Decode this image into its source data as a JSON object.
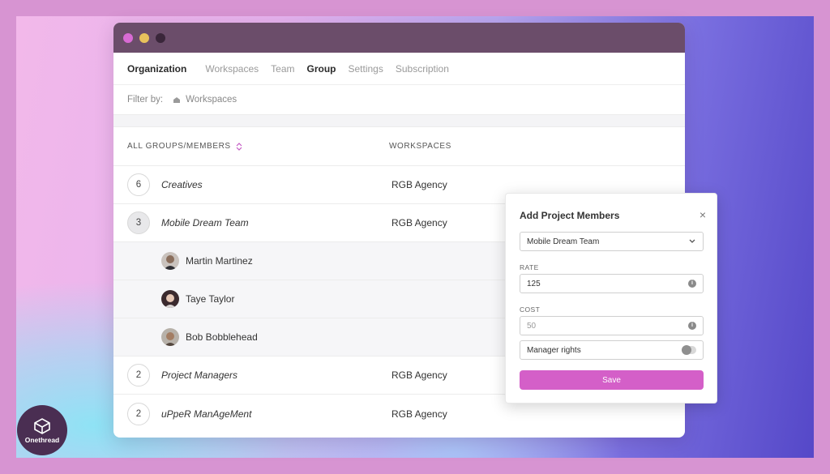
{
  "colors": {
    "dot_pink": "#d86bd4",
    "dot_yellow": "#e8c25c",
    "dot_dark": "#3a263a",
    "accent": "#d45fc8"
  },
  "nav": {
    "items": [
      {
        "label": "Organization",
        "bold": true
      },
      {
        "label": "Workspaces",
        "bold": false
      },
      {
        "label": "Team",
        "bold": false
      },
      {
        "label": "Group",
        "bold": true
      },
      {
        "label": "Settings",
        "bold": false
      },
      {
        "label": "Subscription",
        "bold": false
      }
    ]
  },
  "filter": {
    "label": "Filter by:",
    "chip_icon": "building-icon",
    "chip_label": "Workspaces"
  },
  "table": {
    "col_groups": "ALL GROUPS/MEMBERS",
    "col_workspaces": "WORKSPACES",
    "sort_icon": "sort-icon",
    "rows": [
      {
        "type": "group",
        "count": "6",
        "name": "Creatives",
        "workspace": "RGB Agency",
        "expanded": false
      },
      {
        "type": "group",
        "count": "3",
        "name": "Mobile Dream Team",
        "workspace": "RGB Agency",
        "expanded": true
      },
      {
        "type": "member",
        "name": "Martin Martinez"
      },
      {
        "type": "member",
        "name": "Taye Taylor"
      },
      {
        "type": "member",
        "name": "Bob Bobblehead"
      },
      {
        "type": "group",
        "count": "2",
        "name": "Project Managers",
        "workspace": "RGB Agency",
        "expanded": false
      },
      {
        "type": "group",
        "count": "2",
        "name": "uPpeR ManAgeMent",
        "workspace": "RGB Agency",
        "expanded": false
      }
    ]
  },
  "modal": {
    "title": "Add Project Members",
    "close": "×",
    "group_select": "Mobile Dream Team",
    "rate_label": "RATE",
    "rate_value": "125",
    "cost_label": "COST",
    "cost_value": "50",
    "manager_label": "Manager rights",
    "manager_on": false,
    "save_label": "Save"
  },
  "brand": {
    "name": "Onethread"
  }
}
